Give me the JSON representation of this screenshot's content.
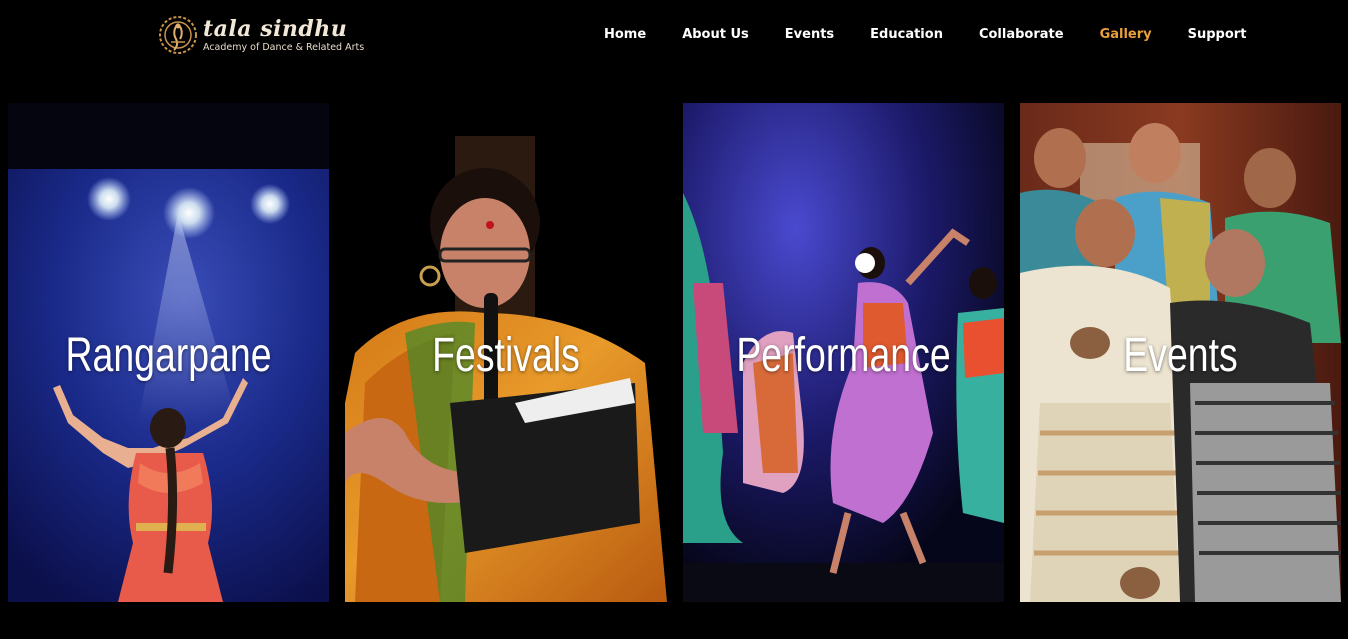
{
  "brand": {
    "name": "tala sindhu",
    "tagline": "Academy of Dance & Related Arts",
    "logo_icon": "dancer-emblem-icon"
  },
  "nav": {
    "items": [
      {
        "label": "Home",
        "active": false
      },
      {
        "label": "About Us",
        "active": false
      },
      {
        "label": "Events",
        "active": false
      },
      {
        "label": "Education",
        "active": false
      },
      {
        "label": "Collaborate",
        "active": false
      },
      {
        "label": "Gallery",
        "active": true
      },
      {
        "label": "Support",
        "active": false
      }
    ],
    "active_color": "#e8a03c"
  },
  "gallery": {
    "cards": [
      {
        "title": "Rangarpane"
      },
      {
        "title": "Festivals"
      },
      {
        "title": "Performance"
      },
      {
        "title": "Events"
      }
    ]
  }
}
